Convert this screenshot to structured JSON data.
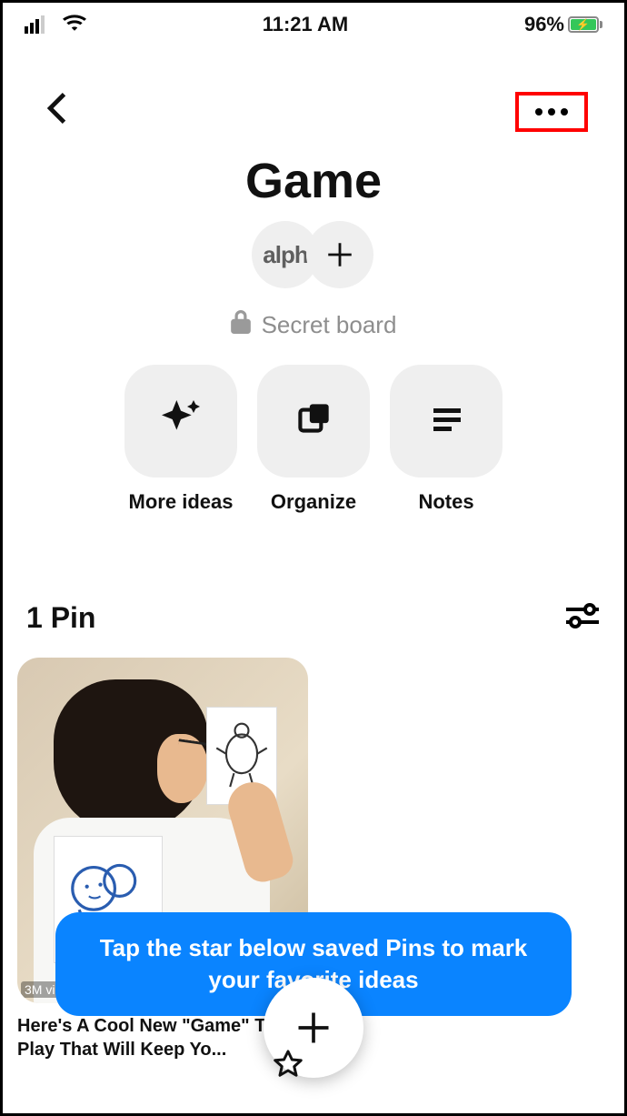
{
  "status": {
    "time": "11:21 AM",
    "battery": "96%"
  },
  "header": {},
  "board": {
    "title": "Game",
    "avatar_text": "alph",
    "secret_label": "Secret board"
  },
  "tiles": [
    {
      "key": "more-ideas",
      "label": "More ideas"
    },
    {
      "key": "organize",
      "label": "Organize"
    },
    {
      "key": "notes",
      "label": "Notes"
    }
  ],
  "section": {
    "count_label": "1 Pin"
  },
  "pins": [
    {
      "views_badge": "3M views",
      "title": "Here's A Cool New \"Game\" To Play That Will Keep Yo..."
    }
  ],
  "toast": {
    "text": "Tap the star below saved Pins to mark your favorite ideas"
  },
  "fab": {
    "label": "+"
  }
}
